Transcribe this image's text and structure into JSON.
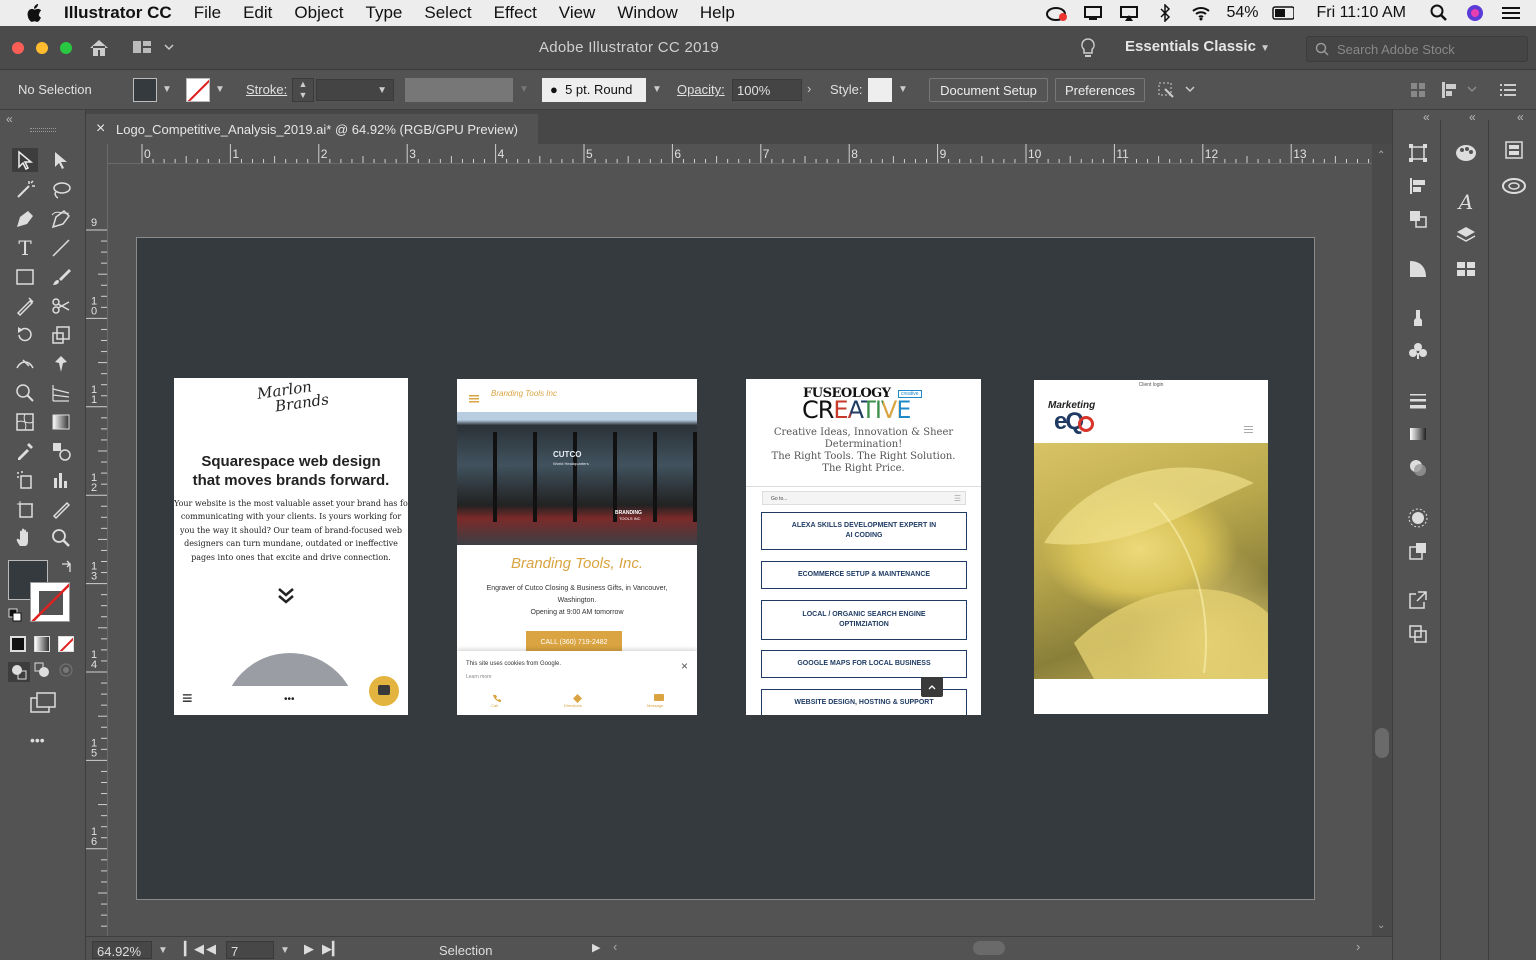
{
  "menubar": {
    "app_name": "Illustrator CC",
    "items": [
      "File",
      "Edit",
      "Object",
      "Type",
      "Select",
      "Effect",
      "View",
      "Window",
      "Help"
    ],
    "battery": "54%",
    "clock": "Fri 11:10 AM"
  },
  "window": {
    "title": "Adobe Illustrator CC 2019",
    "workspace": "Essentials Classic",
    "search_placeholder": "Search Adobe Stock"
  },
  "control": {
    "selection": "No Selection",
    "stroke_label": "Stroke:",
    "brush": "5 pt. Round",
    "opacity_label": "Opacity:",
    "opacity_value": "100%",
    "style_label": "Style:",
    "doc_setup": "Document Setup",
    "preferences": "Preferences"
  },
  "document": {
    "tab_title": "Logo_Competitive_Analysis_2019.ai* @ 64.92% (RGB/GPU Preview)",
    "close": "×"
  },
  "rulers": {
    "h": [
      "0",
      "1",
      "2",
      "3",
      "4",
      "5",
      "6",
      "7",
      "8",
      "9",
      "10",
      "11",
      "12",
      "13"
    ],
    "v": [
      "9",
      "10",
      "11",
      "12",
      "13",
      "14",
      "15",
      "16"
    ]
  },
  "status": {
    "zoom": "64.92%",
    "artboard": "7",
    "tool": "Selection"
  },
  "toolbar_more": "•••",
  "screens": {
    "marlon": {
      "logo1": "Marlon",
      "logo2": "Brands",
      "headline1": "Squarespace web design",
      "headline2": "that moves brands forward.",
      "body": [
        "Your website is the most valuable asset your brand has for",
        "communicating with your clients. Is yours working for",
        "you the way it should? Our team of brand-focused web",
        "designers can turn mundane, outdated or ineffective",
        "pages into ones that excite and drive connection."
      ],
      "menu_icon": "≡",
      "dots": "•••"
    },
    "branding": {
      "header": "Branding Tools Inc",
      "storefront_sign1": "CUTCO",
      "storefront_sign2": "World Headquarters",
      "storefront_sign3": "BRANDING",
      "storefront_sign4": "TOOLS INC",
      "title": "Branding Tools, Inc.",
      "desc1": "Engraver of Cutco Closing & Business Gifts, in Vancouver,",
      "desc2": "Washington.",
      "hours": "Opening at 9:00 AM tomorrow",
      "cta": "CALL (360) 719-2482",
      "cookie": "This site uses cookies from Google.",
      "learn": "Learn more",
      "close": "×",
      "nav": [
        "Call",
        "Directions",
        "Message"
      ]
    },
    "fuseology": {
      "logo_top": "FUSEOLOGY",
      "logo_badge": "creative",
      "logo_main": "CREATIVE",
      "tag1": "Creative Ideas, Innovation & Sheer",
      "tag2": "Determination!",
      "tag3": "The Right Tools. The Right Solution.",
      "tag4": "The Right Price.",
      "goto": "Go to...",
      "buttons": [
        [
          "ALEXA SKILLS DEVELOPMENT EXPERT IN",
          "AI CODING"
        ],
        [
          "ECOMMERCE SETUP & MAINTENANCE"
        ],
        [
          "LOCAL / ORGANIC SEARCH ENGINE",
          "OPTIMZIATION"
        ],
        [
          "GOOGLE MAPS FOR LOCAL BUSINESS"
        ],
        [
          "WEBSITE DESIGN, HOSTING & SUPPORT"
        ]
      ]
    },
    "marketing": {
      "client_login": "Client login",
      "logo_top": "Marketing",
      "logo_main": "eQ"
    }
  },
  "colors": {
    "artboard": "#343a3d",
    "ui": "#535353",
    "gold": "#d9a441",
    "navy": "#1f3b63"
  }
}
